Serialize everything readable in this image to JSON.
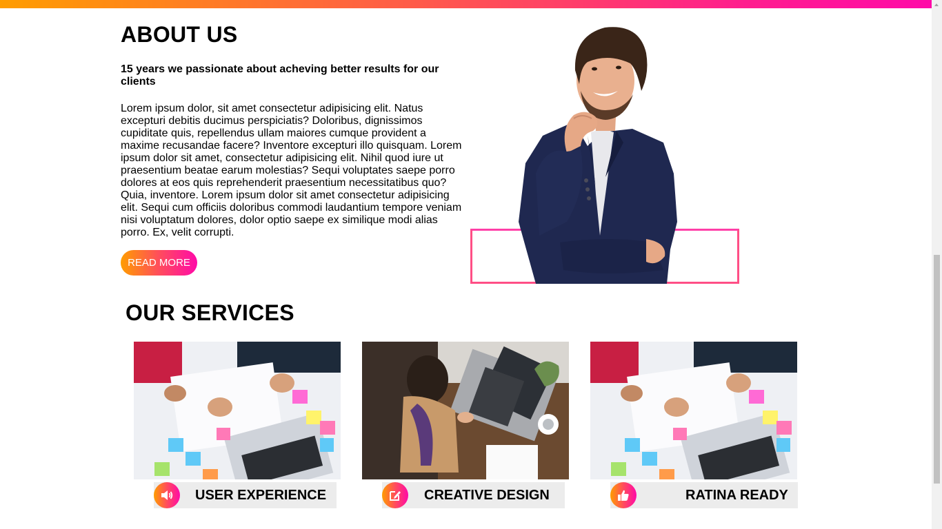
{
  "colors": {
    "accent_start": "#ff9d00",
    "accent_end": "#ff0aa8",
    "label_bg": "#ececec"
  },
  "about": {
    "title": "ABOUT US",
    "subtitle": "15 years we passionate about acheving better results for our clients",
    "body": "Lorem ipsum dolor, sit amet consectetur adipisicing elit. Natus excepturi debitis ducimus perspiciatis? Doloribus, dignissimos cupiditate quis, repellendus ullam maiores cumque provident a maxime recusandae facere? Inventore excepturi illo quisquam. Lorem ipsum dolor sit amet, consectetur adipisicing elit. Nihil quod iure ut praesentium beatae earum molestias? Sequi voluptates saepe porro dolores at eos quis reprehenderit praesentium necessitatibus quo? Quia, inventore. Lorem ipsum dolor sit amet consectetur adipisicing elit. Sequi cum officiis doloribus commodi laudantium tempore veniam nisi voluptatum dolores, dolor optio saepe ex similique modi alias porro. Ex, velit corrupti.",
    "button_label": "READ MORE"
  },
  "services": {
    "title": "OUR SERVICES",
    "items": [
      {
        "label": "USER EXPERIENCE",
        "icon": "volume-icon",
        "image": "team-sketching-wireframes-photo"
      },
      {
        "label": "CREATIVE DESIGN",
        "icon": "edit-icon",
        "image": "woman-using-laptop-photo"
      },
      {
        "label": "RATINA READY",
        "icon": "thumbs-up-icon",
        "image": "team-sketching-wireframes-photo"
      }
    ]
  }
}
